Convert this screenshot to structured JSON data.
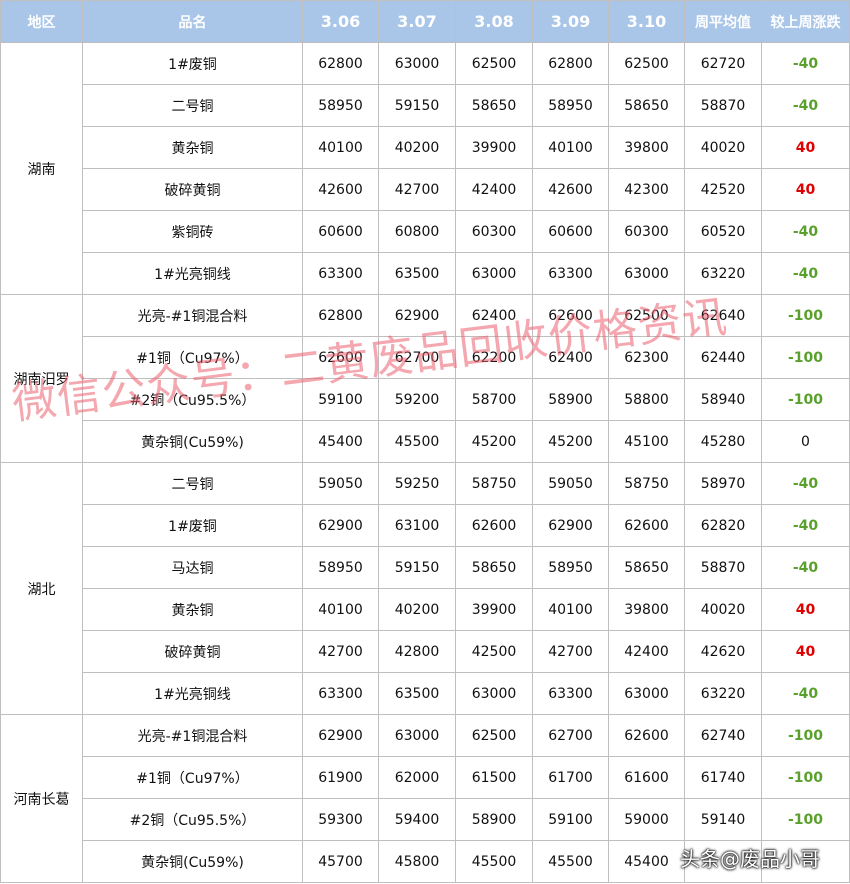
{
  "headers": [
    "地区",
    "品名",
    "3.06",
    "3.07",
    "3.08",
    "3.09",
    "3.10",
    "周平均值",
    "较上周涨跌"
  ],
  "colors": {
    "header_bg": "#a9c6e8",
    "decrease": "#5aa02c",
    "increase": "#e00000",
    "watermark": "#eb5f6e"
  },
  "groups": [
    {
      "region": "湖南",
      "rows": [
        {
          "name": "1#废铜",
          "v306": "62800",
          "v307": "63000",
          "v308": "62500",
          "v309": "62800",
          "v310": "62500",
          "avg": "62720",
          "change": "-40"
        },
        {
          "name": "二号铜",
          "v306": "58950",
          "v307": "59150",
          "v308": "58650",
          "v309": "58950",
          "v310": "58650",
          "avg": "58870",
          "change": "-40"
        },
        {
          "name": "黄杂铜",
          "v306": "40100",
          "v307": "40200",
          "v308": "39900",
          "v309": "40100",
          "v310": "39800",
          "avg": "40020",
          "change": "40"
        },
        {
          "name": "破碎黄铜",
          "v306": "42600",
          "v307": "42700",
          "v308": "42400",
          "v309": "42600",
          "v310": "42300",
          "avg": "42520",
          "change": "40"
        },
        {
          "name": "紫铜砖",
          "v306": "60600",
          "v307": "60800",
          "v308": "60300",
          "v309": "60600",
          "v310": "60300",
          "avg": "60520",
          "change": "-40"
        },
        {
          "name": "1#光亮铜线",
          "v306": "63300",
          "v307": "63500",
          "v308": "63000",
          "v309": "63300",
          "v310": "63000",
          "avg": "63220",
          "change": "-40"
        }
      ]
    },
    {
      "region": "湖南汨罗",
      "rows": [
        {
          "name": "光亮-#1铜混合料",
          "v306": "62800",
          "v307": "62900",
          "v308": "62400",
          "v309": "62600",
          "v310": "62500",
          "avg": "62640",
          "change": "-100"
        },
        {
          "name": "#1铜（Cu97%）",
          "v306": "62600",
          "v307": "62700",
          "v308": "62200",
          "v309": "62400",
          "v310": "62300",
          "avg": "62440",
          "change": "-100"
        },
        {
          "name": "#2铜（Cu95.5%）",
          "v306": "59100",
          "v307": "59200",
          "v308": "58700",
          "v309": "58900",
          "v310": "58800",
          "avg": "58940",
          "change": "-100"
        },
        {
          "name": "黄杂铜(Cu59%)",
          "v306": "45400",
          "v307": "45500",
          "v308": "45200",
          "v309": "45200",
          "v310": "45100",
          "avg": "45280",
          "change": "0"
        }
      ]
    },
    {
      "region": "湖北",
      "rows": [
        {
          "name": "二号铜",
          "v306": "59050",
          "v307": "59250",
          "v308": "58750",
          "v309": "59050",
          "v310": "58750",
          "avg": "58970",
          "change": "-40"
        },
        {
          "name": "1#废铜",
          "v306": "62900",
          "v307": "63100",
          "v308": "62600",
          "v309": "62900",
          "v310": "62600",
          "avg": "62820",
          "change": "-40"
        },
        {
          "name": "马达铜",
          "v306": "58950",
          "v307": "59150",
          "v308": "58650",
          "v309": "58950",
          "v310": "58650",
          "avg": "58870",
          "change": "-40"
        },
        {
          "name": "黄杂铜",
          "v306": "40100",
          "v307": "40200",
          "v308": "39900",
          "v309": "40100",
          "v310": "39800",
          "avg": "40020",
          "change": "40"
        },
        {
          "name": "破碎黄铜",
          "v306": "42700",
          "v307": "42800",
          "v308": "42500",
          "v309": "42700",
          "v310": "42400",
          "avg": "42620",
          "change": "40"
        },
        {
          "name": "1#光亮铜线",
          "v306": "63300",
          "v307": "63500",
          "v308": "63000",
          "v309": "63300",
          "v310": "63000",
          "avg": "63220",
          "change": "-40"
        }
      ]
    },
    {
      "region": "河南长葛",
      "rows": [
        {
          "name": "光亮-#1铜混合料",
          "v306": "62900",
          "v307": "63000",
          "v308": "62500",
          "v309": "62700",
          "v310": "62600",
          "avg": "62740",
          "change": "-100"
        },
        {
          "name": "#1铜（Cu97%）",
          "v306": "61900",
          "v307": "62000",
          "v308": "61500",
          "v309": "61700",
          "v310": "61600",
          "avg": "61740",
          "change": "-100"
        },
        {
          "name": "#2铜（Cu95.5%）",
          "v306": "59300",
          "v307": "59400",
          "v308": "58900",
          "v309": "59100",
          "v310": "59000",
          "avg": "59140",
          "change": "-100"
        },
        {
          "name": "黄杂铜(Cu59%)",
          "v306": "45700",
          "v307": "45800",
          "v308": "45500",
          "v309": "45500",
          "v310": "45400",
          "avg": "",
          "change": ""
        }
      ]
    }
  ],
  "watermark": "微信公众号：二黄废品回收价格资讯",
  "credit": "头条@废品小哥"
}
